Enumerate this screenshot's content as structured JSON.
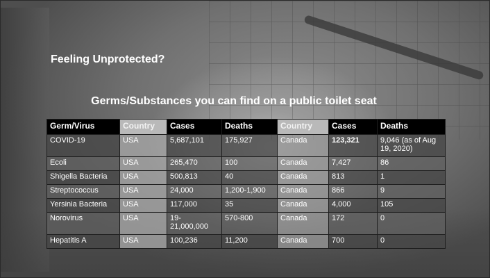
{
  "slide": {
    "title": "Feeling Unprotected?",
    "subtitle": "Germs/Substances you can find on a public toilet seat"
  },
  "table": {
    "headers": [
      "Germ/Virus",
      "Country",
      "Cases",
      "Deaths",
      "Country",
      "Cases",
      "Deaths"
    ],
    "rows": [
      {
        "germ": "COVID-19",
        "country1": "USA",
        "cases1": "5,687,101",
        "deaths1": "175,927",
        "country2": "Canada",
        "cases2": "123,321",
        "deaths2": "9,046 (as of Aug 19, 2020)"
      },
      {
        "germ": "Ecoli",
        "country1": "USA",
        "cases1": "265,470",
        "deaths1": "100",
        "country2": "Canada",
        "cases2": "7,427",
        "deaths2": "86"
      },
      {
        "germ": "Shigella Bacteria",
        "country1": "USA",
        "cases1": "500,813",
        "deaths1": "40",
        "country2": "Canada",
        "cases2": "813",
        "deaths2": "1"
      },
      {
        "germ": "Streptococcus",
        "country1": "USA",
        "cases1": "24,000",
        "deaths1": "1,200-1,900",
        "country2": "Canada",
        "cases2": "866",
        "deaths2": "9"
      },
      {
        "germ": "Yersinia Bacteria",
        "country1": "USA",
        "cases1": "117,000",
        "deaths1": "35",
        "country2": "Canada",
        "cases2": "4,000",
        "deaths2": "105"
      },
      {
        "germ": "Norovirus",
        "country1": "USA",
        "cases1": "19-21,000,000",
        "deaths1": "570-800",
        "country2": "Canada",
        "cases2": "172",
        "deaths2": "0"
      },
      {
        "germ": "Hepatitis A",
        "country1": "USA",
        "cases1": "100,236",
        "deaths1": "11,200",
        "country2": "Canada",
        "cases2": "700",
        "deaths2": "0"
      }
    ]
  }
}
